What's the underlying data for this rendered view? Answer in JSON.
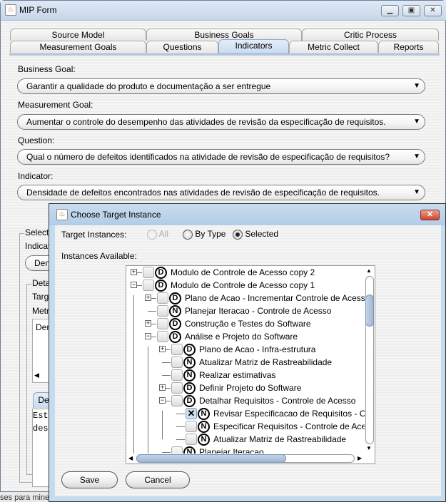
{
  "window": {
    "title": "MIP Form"
  },
  "tabs_row1": [
    "Source Model",
    "Business Goals",
    "Critic Process"
  ],
  "tabs_row2": [
    "Measurement Goals",
    "Questions",
    "Indicators",
    "Metric Collect",
    "Reports"
  ],
  "selected_tab": "Indicators",
  "form": {
    "business_goal_label": "Business Goal:",
    "business_goal_value": "Garantir a qualidade do produto e documentação a ser entregue",
    "measurement_goal_label": "Measurement Goal:",
    "measurement_goal_value": "Aumentar o controle do desempenho das atividades de revisão da especificação de requisitos.",
    "question_label": "Question:",
    "question_value": "Qual o número de defeitos identificados na atividade de revisão de especificação de requisitos?",
    "indicator_label": "Indicator:",
    "indicator_value": "Densidade de defeitos encontrados nas atividades de revisão de especificação de requisitos."
  },
  "background_partial": {
    "select_group": "Select",
    "indicator_label": "Indicat",
    "combo_text": "Den",
    "details_group": "Deta",
    "target_label": "Targ",
    "metric_label": "Metr",
    "list_text": "Den",
    "tab_label": "De",
    "desc_line1": "Este",
    "desc_line2": "dese",
    "bottom_text": "ses para mine"
  },
  "dialog": {
    "title": "Choose Target Instance",
    "target_instances_label": "Target Instances:",
    "radio_all": "All",
    "radio_by_type": "By Type",
    "radio_selected": "Selected",
    "selected_option": "Selected",
    "instances_label": "Instances Available:",
    "tree": [
      {
        "level": 0,
        "expander": "+",
        "type": "D",
        "label": "Modulo de Controle de Acesso copy 2",
        "checked": false
      },
      {
        "level": 0,
        "expander": "-",
        "type": "D",
        "label": "Modulo de Controle de Acesso copy 1",
        "checked": false
      },
      {
        "level": 1,
        "expander": "+",
        "type": "D",
        "label": "Plano de Acao - Incrementar Controle de Acesso",
        "checked": false
      },
      {
        "level": 1,
        "expander": "",
        "type": "N",
        "label": "Planejar Iteracao - Controle de Acesso",
        "checked": false
      },
      {
        "level": 1,
        "expander": "+",
        "type": "D",
        "label": "Construção e Testes do Software",
        "checked": false
      },
      {
        "level": 1,
        "expander": "-",
        "type": "D",
        "label": "Análise e Projeto do Software",
        "checked": false
      },
      {
        "level": 2,
        "expander": "+",
        "type": "D",
        "label": "Plano de Acao - Infra-estrutura",
        "checked": false
      },
      {
        "level": 2,
        "expander": "",
        "type": "N",
        "label": "Atualizar Matriz de Rastreabilidade",
        "checked": false
      },
      {
        "level": 2,
        "expander": "",
        "type": "N",
        "label": "Realizar estimativas",
        "checked": false
      },
      {
        "level": 2,
        "expander": "+",
        "type": "D",
        "label": "Definir Projeto do Software",
        "checked": false
      },
      {
        "level": 2,
        "expander": "-",
        "type": "D",
        "label": "Detalhar Requisitos - Controle de Acesso",
        "checked": false
      },
      {
        "level": 3,
        "expander": "",
        "type": "N",
        "label": "Revisar Especificacao de Requisitos - Controle de Acesso",
        "checked": true
      },
      {
        "level": 3,
        "expander": "",
        "type": "N",
        "label": "Especificar Requisitos - Controle de Acesso",
        "checked": false
      },
      {
        "level": 3,
        "expander": "",
        "type": "N",
        "label": "Atualizar Matriz de Rastreabilidade",
        "checked": false
      },
      {
        "level": 2,
        "expander": "",
        "type": "N",
        "label": "Planejar Iteracao",
        "checked": false
      }
    ],
    "save_label": "Save",
    "cancel_label": "Cancel"
  }
}
